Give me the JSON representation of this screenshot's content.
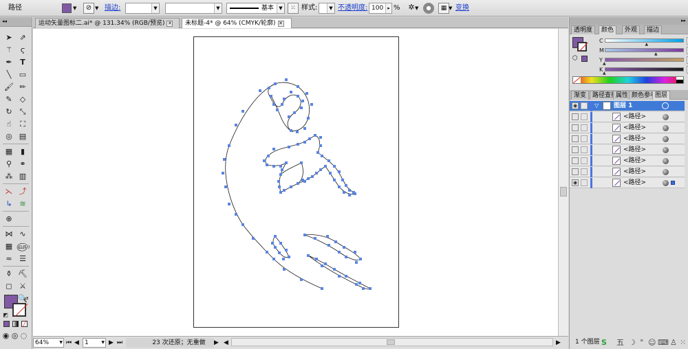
{
  "control_bar": {
    "object_type": "路径",
    "fill_color": "#8058a4",
    "stroke_label": "描边:",
    "stroke_weight": "",
    "brush_value": "",
    "stroke_profile": "基本",
    "style_label": "样式:",
    "opacity_label": "不透明度:",
    "opacity_value": "100",
    "opacity_unit": "%",
    "transform_link": "变换"
  },
  "tabs": [
    {
      "label": "运动矢量图标二.ai* @ 131.34% (RGB/预览)",
      "close": "✕"
    },
    {
      "label": "未标题-4* @ 64% (CMYK/轮廓)",
      "close": "✕"
    }
  ],
  "toolbox": {
    "collapse_glyph": "◂◂",
    "fill_color": "#8058a4",
    "stroke_color": "#ffffff"
  },
  "status_bar": {
    "zoom": "64%",
    "artboard": "1",
    "status_text": "23 次还原；无重做"
  },
  "color_panel": {
    "tabs": [
      "透明度",
      "颜色",
      "外观",
      "描边"
    ],
    "fill_color": "#8058a4",
    "channels": [
      {
        "name": "C",
        "value": "53.52",
        "unit": "%",
        "fraction": 0.535,
        "gradient": "linear-gradient(90deg,#fff,#00a0e9)"
      },
      {
        "name": "M",
        "value": "65.23",
        "unit": "%",
        "fraction": 0.652,
        "gradient": "linear-gradient(90deg,#a8c8e8,#7a3aa0)"
      },
      {
        "name": "Y",
        "value": "0",
        "unit": "%",
        "fraction": 0.0,
        "gradient": "linear-gradient(90deg,#8a5bb0,#c0a060)"
      },
      {
        "name": "K",
        "value": "0",
        "unit": "%",
        "fraction": 0.0,
        "gradient": "linear-gradient(90deg,#8a5bb0,#1a1a1a)"
      }
    ]
  },
  "layers_panel": {
    "tabs": [
      "渐变",
      "路径查找",
      "属性",
      "颜色参考",
      "图层"
    ],
    "layer_name": "图层 1",
    "items": [
      {
        "name": "<路径>",
        "visible": false
      },
      {
        "name": "<路径>",
        "visible": false
      },
      {
        "name": "<路径>",
        "visible": false
      },
      {
        "name": "<路径>",
        "visible": false
      },
      {
        "name": "<路径>",
        "visible": false
      },
      {
        "name": "<路径>",
        "visible": false
      },
      {
        "name": "<路径>",
        "visible": true
      }
    ],
    "footer": "1 个图层"
  }
}
